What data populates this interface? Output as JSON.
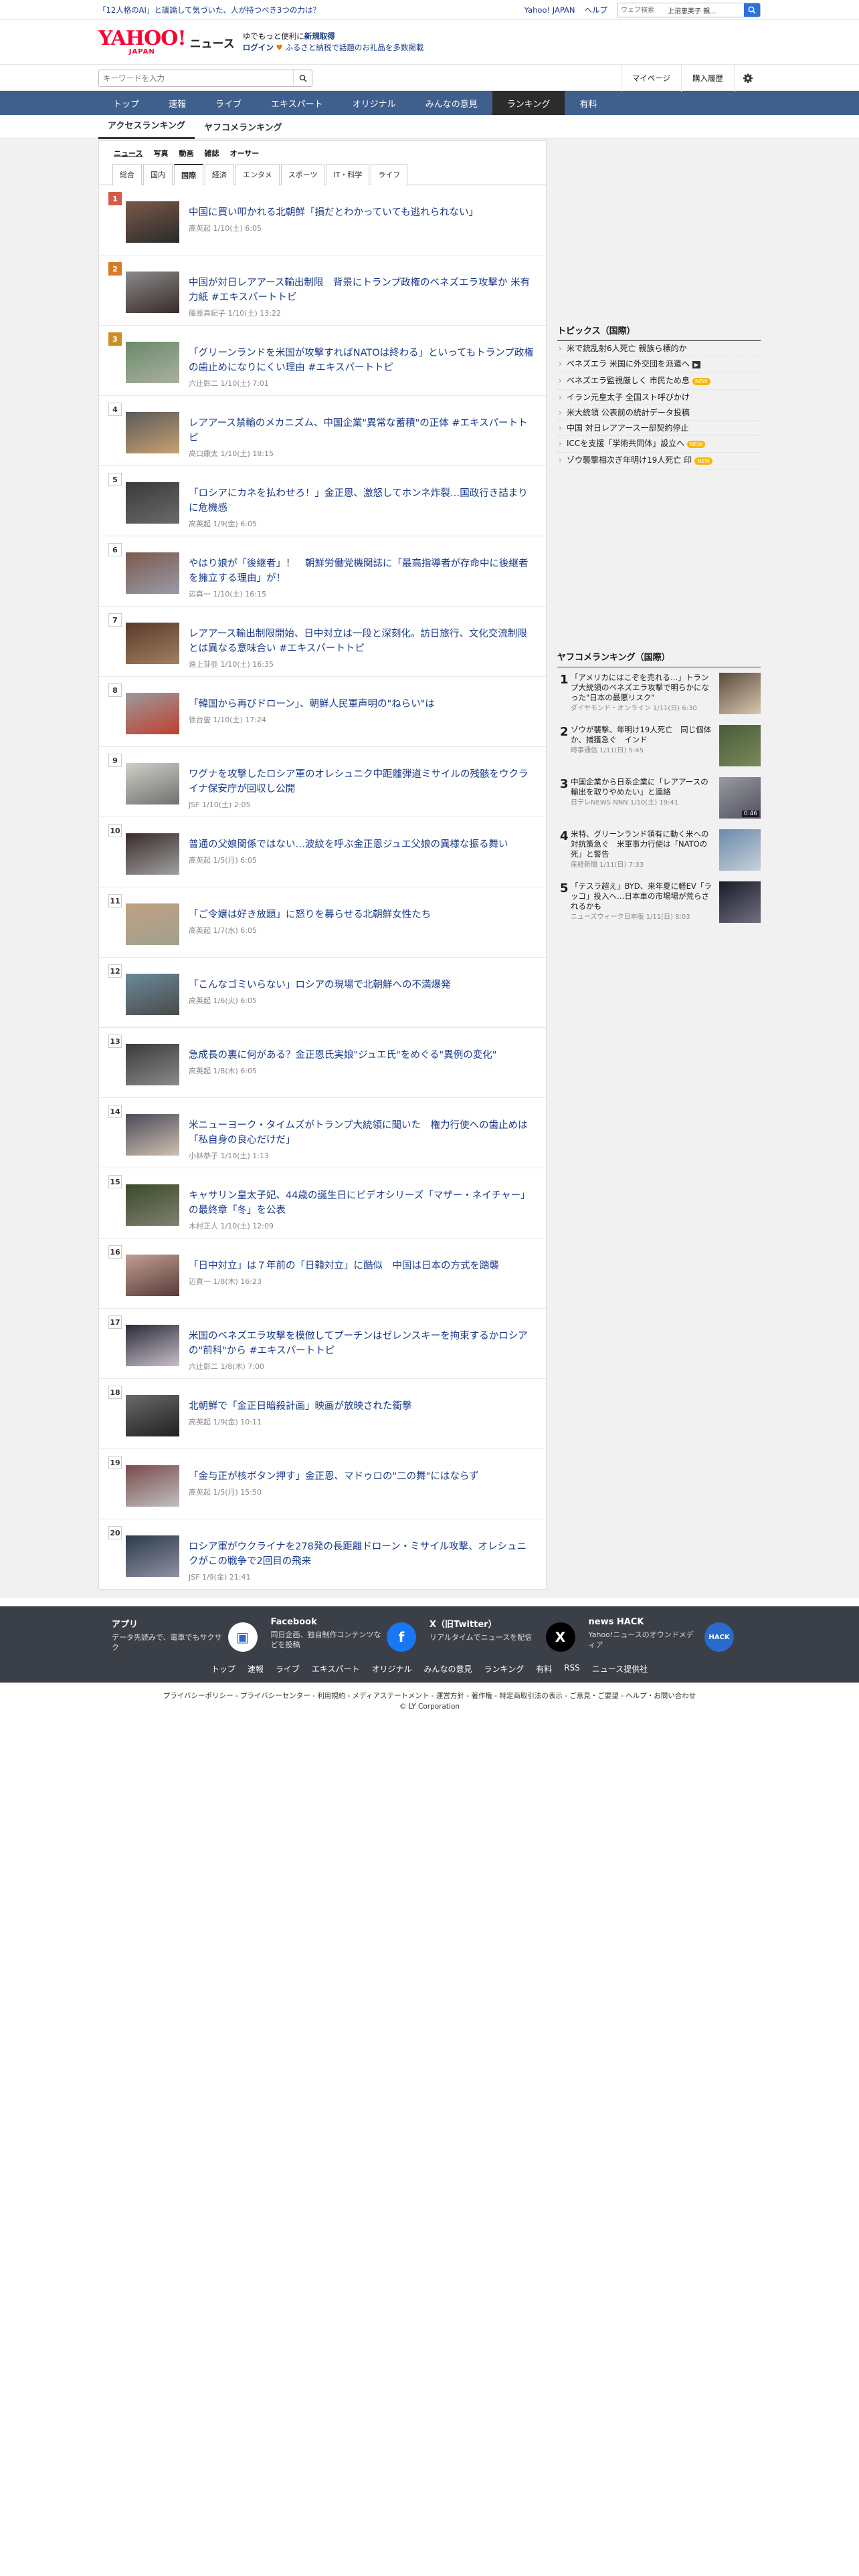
{
  "topstrip": {
    "promo": "「12人格のAI」と議論して気づいた、人が持つべき3つの力は？",
    "links": [
      "Yahoo! JAPAN",
      "ヘルプ"
    ],
    "search_placeholder": "ウェブ検索",
    "search_suggestion": "上沼恵美子 親..."
  },
  "header": {
    "logo": "YAHOO!",
    "logo_sub": "JAPAN",
    "section": "ニュース",
    "promo_line1_pre": "ゆでもっと便利に",
    "promo_line1_em": "新規取得",
    "promo_line2_login": "ログイン",
    "promo_line2_text": "ふるさと納税で話題のお礼品を多数掲載"
  },
  "search": {
    "placeholder": "キーワードを入力",
    "mypage": "マイページ",
    "history": "購入履歴"
  },
  "nav": [
    "トップ",
    "速報",
    "ライブ",
    "エキスパート",
    "オリジナル",
    "みんなの意見",
    "ランキング",
    "有料"
  ],
  "nav_active": 6,
  "subtabs": [
    "アクセスランキング",
    "ヤフコメランキング"
  ],
  "media_tabs": [
    "ニュース",
    "写真",
    "動画",
    "雑誌",
    "オーサー"
  ],
  "category_tabs": [
    "総合",
    "国内",
    "国際",
    "経済",
    "エンタメ",
    "スポーツ",
    "IT・科学",
    "ライフ"
  ],
  "category_active": 2,
  "items": [
    {
      "rank": "1",
      "title": "中国に買い叩かれる北朝鮮「損だとわかっていても逃れられない」",
      "meta": "高英起  1/10(土) 6:05"
    },
    {
      "rank": "2",
      "title": "中国が対日レアアース輸出制限　背景にトランプ政権のベネズエラ攻撃か 米有力紙 #エキスパートトピ",
      "meta": "藤原真紀子  1/10(土) 13:22"
    },
    {
      "rank": "3",
      "title": "「グリーンランドを米国が攻撃すればNATOは終わる」といってもトランプ政権の歯止めになりにくい理由 #エキスパートトピ",
      "meta": "六辻彰二  1/10(土) 7:01"
    },
    {
      "rank": "4",
      "title": "レアアース禁輸のメカニズム、中国企業\"異常な蓄積\"の正体 #エキスパートトピ",
      "meta": "高口康太  1/10(土) 18:15"
    },
    {
      "rank": "5",
      "title": "「ロシアにカネを払わせろ！」金正恩、激怒してホンネ炸裂…国政行き詰まりに危機感",
      "meta": "高英起  1/9(金) 6:05"
    },
    {
      "rank": "6",
      "title": "やはり娘が「後継者」！　朝鮮労働党機関誌に「最高指導者が存命中に後継者を擁立する理由」が！",
      "meta": "辺真一  1/10(土) 16:15"
    },
    {
      "rank": "7",
      "title": "レアアース輸出制限開始、日中対立は一段と深刻化。訪日旅行、文化交流制限とは異なる意味合い #エキスパートトピ",
      "meta": "遠上芽亜  1/10(土) 16:35"
    },
    {
      "rank": "8",
      "title": "「韓国から再びドローン」、朝鮮人民軍声明の\"ねらい\"は",
      "meta": "徐台燮  1/10(土) 17:24"
    },
    {
      "rank": "9",
      "title": "ワグナを攻撃したロシア軍のオレシュニク中距離弾道ミサイルの残骸をウクライナ保安庁が回収し公開",
      "meta": "JSF  1/10(土) 2:05"
    },
    {
      "rank": "10",
      "title": "普通の父娘関係ではない…波紋を呼ぶ金正恩ジュエ父娘の異様な振る舞い",
      "meta": "高英起  1/5(月) 6:05"
    },
    {
      "rank": "11",
      "title": "「ご令嬢は好き放題」に怒りを募らせる北朝鮮女性たち",
      "meta": "高英起  1/7(水) 6:05"
    },
    {
      "rank": "12",
      "title": "「こんなゴミいらない」ロシアの現場で北朝鮮への不満爆発",
      "meta": "高英起  1/6(火) 6:05"
    },
    {
      "rank": "13",
      "title": "急成長の裏に何がある？金正恩氏実娘\"ジュエ氏\"をめぐる\"異例の変化\"",
      "meta": "高英起  1/8(木) 6:05"
    },
    {
      "rank": "14",
      "title": "米ニューヨーク・タイムズがトランプ大統領に聞いた　権力行使への歯止めは「私自身の良心だけだ」",
      "meta": "小林恭子  1/10(土) 1:13"
    },
    {
      "rank": "15",
      "title": "キャサリン皇太子妃、44歳の誕生日にビデオシリーズ「マザー・ネイチャー」の最終章「冬」を公表",
      "meta": "木村正人  1/10(土) 12:09"
    },
    {
      "rank": "16",
      "title": "「日中対立」は７年前の「日韓対立」に酷似　中国は日本の方式を踏襲",
      "meta": "辺真一  1/8(木) 16:23"
    },
    {
      "rank": "17",
      "title": "米国のベネズエラ攻撃を模倣してプーチンはゼレンスキーを拘束するかロシアの\"前科\"から #エキスパートトピ",
      "meta": "六辻彰二  1/8(木) 7:00"
    },
    {
      "rank": "18",
      "title": "北朝鮮で「金正日暗殺計画」映画が放映された衝撃",
      "meta": "高英起  1/9(金) 10:11"
    },
    {
      "rank": "19",
      "title": "「金与正が核ボタン押す」金正恩、マドゥロの\"二の舞\"にはならず",
      "meta": "高英起  1/5(月) 15:50"
    },
    {
      "rank": "20",
      "title": "ロシア軍がウクライナを278発の長距離ドローン・ミサイル攻撃、オレシュニクがこの戦争で2回目の飛来",
      "meta": "JSF  1/9(金) 21:41"
    }
  ],
  "topics": {
    "heading": "トピックス（国際）",
    "list": [
      {
        "text": "米で銃乱射6人死亡 親族ら標的か",
        "badge": ""
      },
      {
        "text": "ベネズエラ 米国に外交団を派遣へ",
        "badge": "video"
      },
      {
        "text": "ベネズエラ監視厳しく 市民ため息",
        "badge": "new"
      },
      {
        "text": "イラン元皇太子 全国スト呼びかけ",
        "badge": ""
      },
      {
        "text": "米大統領 公表前の統計データ投稿",
        "badge": ""
      },
      {
        "text": "中国 対日レアアース一部契約停止",
        "badge": ""
      },
      {
        "text": "ICCを支援「学術共同体」設立へ",
        "badge": "new"
      },
      {
        "text": "ゾウ襲撃相次ぎ年明け19人死亡 印",
        "badge": "new"
      }
    ],
    "badge_new": "NEW"
  },
  "yahoo_comment_ranking": {
    "heading": "ヤフコメランキング（国際）",
    "list": [
      {
        "rank": "1",
        "title": "「アメリカにはこぞを売れる…」トランプ大統領のベネズエラ攻撃で明らかになった\"日本の最悪リスク\"",
        "meta": "ダイヤモンド・オンライン 1/11(日) 6:30"
      },
      {
        "rank": "2",
        "title": "ゾウが襲撃、年明け19人死亡　同じ個体か、捕獲急ぐ　インド",
        "meta": "時事通信 1/11(日) 5:45"
      },
      {
        "rank": "3",
        "title": "中国企業から日系企業に「レアアースの輸出を取りやめたい」と連絡",
        "meta": "日テレNEWS NNN 1/10(土) 19:41",
        "badge": "0:46"
      },
      {
        "rank": "4",
        "title": "米特、グリーンランド領有に動く米への対抗策急ぐ　米軍事力行使は「NATOの死」と警告",
        "meta": "産経新聞 1/11(日) 7:33"
      },
      {
        "rank": "5",
        "title": "「テスラ超え」BYD、来年夏に軽EV「ラッコ」投入へ…日本車の市場場が荒らされるかも",
        "meta": "ニューズウィーク日本版 1/11(日) 8:03"
      }
    ]
  },
  "footer": {
    "apps": [
      {
        "title": "アプリ",
        "desc": "データ先読みで、電車でもサクサク",
        "icon": "app-icon"
      },
      {
        "title": "Facebook",
        "desc": "同日企画、独自制作コンテンツなどを投稿",
        "icon": "facebook-icon"
      },
      {
        "title": "X（旧Twitter）",
        "desc": "リアルタイムでニュースを配信",
        "icon": "x-icon"
      },
      {
        "title": "news HACK",
        "desc": "Yahoo!ニュースのオウンドメディア",
        "icon": "newshack-icon"
      }
    ],
    "links": [
      "トップ",
      "速報",
      "ライブ",
      "エキスパート",
      "オリジナル",
      "みんなの意見",
      "ランキング",
      "有料",
      "RSS",
      "ニュース提供社"
    ],
    "legal": "プライバシーポリシー - プライバシーセンター - 利用規約 - メディアステートメント - 運営方針 - 著作権 - 特定商取引法の表示 - ご意見・ご要望 - ヘルプ・お問い合わせ",
    "copyright": "© LY Corporation"
  },
  "colors": {
    "nav": "#3f5f8d",
    "link": "#1a3a8a",
    "accent": "#ff0033",
    "footer": "#3b3f48"
  }
}
